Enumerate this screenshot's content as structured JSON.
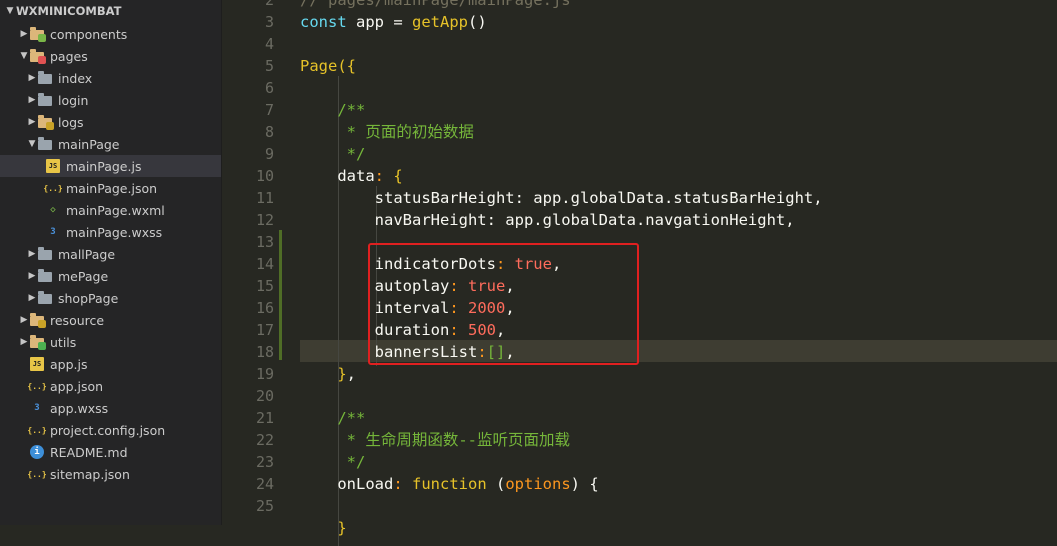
{
  "explorer": {
    "root": "WXMINICOMBAT",
    "items": [
      {
        "label": "components",
        "depth": 1,
        "type": "folder",
        "variant": "gear",
        "expanded": false
      },
      {
        "label": "pages",
        "depth": 1,
        "type": "folder",
        "variant": "red",
        "expanded": true
      },
      {
        "label": "index",
        "depth": 2,
        "type": "folder",
        "variant": "grey",
        "expanded": false
      },
      {
        "label": "login",
        "depth": 2,
        "type": "folder",
        "variant": "grey",
        "expanded": false
      },
      {
        "label": "logs",
        "depth": 2,
        "type": "folder",
        "variant": "yellow",
        "expanded": false
      },
      {
        "label": "mainPage",
        "depth": 2,
        "type": "folder",
        "variant": "grey",
        "expanded": true
      },
      {
        "label": "mainPage.js",
        "depth": 3,
        "type": "file",
        "variant": "js",
        "selected": true
      },
      {
        "label": "mainPage.json",
        "depth": 3,
        "type": "file",
        "variant": "json"
      },
      {
        "label": "mainPage.wxml",
        "depth": 3,
        "type": "file",
        "variant": "wxml"
      },
      {
        "label": "mainPage.wxss",
        "depth": 3,
        "type": "file",
        "variant": "css"
      },
      {
        "label": "mallPage",
        "depth": 2,
        "type": "folder",
        "variant": "grey",
        "expanded": false
      },
      {
        "label": "mePage",
        "depth": 2,
        "type": "folder",
        "variant": "grey",
        "expanded": false
      },
      {
        "label": "shopPage",
        "depth": 2,
        "type": "folder",
        "variant": "grey",
        "expanded": false
      },
      {
        "label": "resource",
        "depth": 1,
        "type": "folder",
        "variant": "yellow",
        "expanded": false
      },
      {
        "label": "utils",
        "depth": 1,
        "type": "folder",
        "variant": "green",
        "expanded": false
      },
      {
        "label": "app.js",
        "depth": 1,
        "type": "file",
        "variant": "js"
      },
      {
        "label": "app.json",
        "depth": 1,
        "type": "file",
        "variant": "json"
      },
      {
        "label": "app.wxss",
        "depth": 1,
        "type": "file",
        "variant": "css"
      },
      {
        "label": "project.config.json",
        "depth": 1,
        "type": "file",
        "variant": "json"
      },
      {
        "label": "README.md",
        "depth": 1,
        "type": "file",
        "variant": "info"
      },
      {
        "label": "sitemap.json",
        "depth": 1,
        "type": "file",
        "variant": "json"
      }
    ]
  },
  "editor": {
    "line_numbers": [
      "2",
      "3",
      "4",
      "5",
      "6",
      "7",
      "8",
      "9",
      "10",
      "11",
      "12",
      "13",
      "14",
      "15",
      "16",
      "17",
      "18",
      "19",
      "20",
      "21",
      "22",
      "23",
      "24",
      "25"
    ],
    "lines": [
      [
        [
          "c-com",
          "// pages/mainPage/mainPage.js"
        ]
      ],
      [
        [
          "c-kw",
          "const"
        ],
        [
          "c-str",
          " app = "
        ],
        [
          "c-yel",
          "getApp"
        ],
        [
          "c-br",
          "()"
        ]
      ],
      [],
      [
        [
          "c-yel",
          "Page"
        ],
        [
          "c-yel",
          "({"
        ]
      ],
      [],
      [
        [
          "c-cn",
          "    /**"
        ]
      ],
      [
        [
          "c-cn",
          "     * 页面的初始数据"
        ]
      ],
      [
        [
          "c-cn",
          "     */"
        ]
      ],
      [
        [
          "c-str",
          "    data"
        ],
        [
          "c-orange",
          ": "
        ],
        [
          "c-yel",
          "{"
        ]
      ],
      [
        [
          "c-str",
          "        statusBarHeight: app.globalData.statusBarHeight,"
        ]
      ],
      [
        [
          "c-str",
          "        navBarHeight: app.globalData.navgationHeight,"
        ]
      ],
      [],
      [
        [
          "c-str",
          "        indicatorDots"
        ],
        [
          "c-orange",
          ": "
        ],
        [
          "c-num",
          "true"
        ],
        [
          "c-str",
          ","
        ]
      ],
      [
        [
          "c-str",
          "        autoplay"
        ],
        [
          "c-orange",
          ": "
        ],
        [
          "c-num",
          "true"
        ],
        [
          "c-str",
          ","
        ]
      ],
      [
        [
          "c-str",
          "        interval"
        ],
        [
          "c-orange",
          ": "
        ],
        [
          "c-num",
          "2000"
        ],
        [
          "c-str",
          ","
        ]
      ],
      [
        [
          "c-str",
          "        duration"
        ],
        [
          "c-orange",
          ": "
        ],
        [
          "c-num",
          "500"
        ],
        [
          "c-str",
          ","
        ]
      ],
      [
        [
          "c-str",
          "        bannersList"
        ],
        [
          "c-orange",
          ":"
        ],
        [
          "c-cn",
          "[]"
        ],
        [
          "c-str",
          ","
        ]
      ],
      [
        [
          "c-yel",
          "    }"
        ],
        [
          "c-str",
          ","
        ]
      ],
      [],
      [
        [
          "c-cn",
          "    /**"
        ]
      ],
      [
        [
          "c-cn",
          "     * 生命周期函数--监听页面加载"
        ]
      ],
      [
        [
          "c-cn",
          "     */"
        ]
      ],
      [
        [
          "c-str",
          "    onLoad"
        ],
        [
          "c-orange",
          ": "
        ],
        [
          "c-yel",
          "function"
        ],
        [
          "c-str",
          " ("
        ],
        [
          "c-par",
          "options"
        ],
        [
          "c-str",
          ") {"
        ]
      ],
      [],
      [
        [
          "c-yel",
          "    }"
        ]
      ]
    ]
  }
}
